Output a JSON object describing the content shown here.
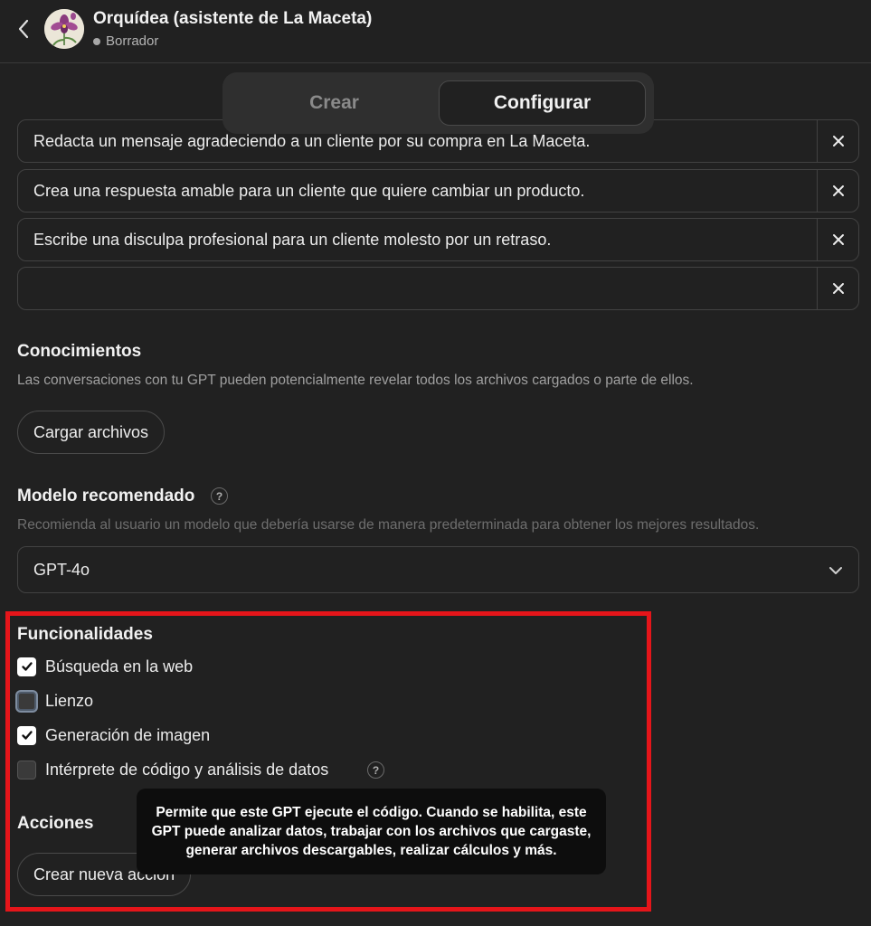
{
  "header": {
    "back_icon": "chevron-left-icon",
    "title": "Orquídea (asistente de La Maceta)",
    "status": "Borrador",
    "avatar": "orchid-avatar"
  },
  "tabs": [
    {
      "label": "Crear",
      "active": false
    },
    {
      "label": "Configurar",
      "active": true
    }
  ],
  "conversation_starters": [
    "Redacta un mensaje agradeciendo a un cliente por su compra en La Maceta.",
    "Crea una respuesta amable para un cliente que quiere cambiar un producto.",
    "Escribe una disculpa profesional para un cliente molesto por un retraso.",
    ""
  ],
  "knowledge": {
    "title": "Conocimientos",
    "description": "Las conversaciones con tu GPT pueden potencialmente revelar todos los archivos cargados o parte de ellos.",
    "upload_label": "Cargar archivos"
  },
  "model": {
    "title": "Modelo recomendado",
    "description": "Recomienda al usuario un modelo que debería usarse de manera predeterminada para obtener los mejores resultados.",
    "selected": "GPT-4o",
    "help": "?"
  },
  "capabilities": {
    "title": "Funcionalidades",
    "items": [
      {
        "label": "Búsqueda en la web",
        "checked": true
      },
      {
        "label": "Lienzo",
        "checked": false
      },
      {
        "label": "Generación de imagen",
        "checked": true
      },
      {
        "label": "Intérprete de código y análisis de datos",
        "checked": false
      }
    ],
    "help": "?",
    "tooltip": "Permite que este GPT ejecute el código. Cuando se habilita, este GPT puede analizar datos, trabajar con los archivos que cargaste, generar archivos descargables, realizar cálculos y más."
  },
  "actions": {
    "title": "Acciones",
    "create_label": "Crear nueva acción"
  },
  "colors": {
    "background": "#212121",
    "highlight": "#e5151a",
    "tooltip_bg": "#0d0d0d"
  }
}
